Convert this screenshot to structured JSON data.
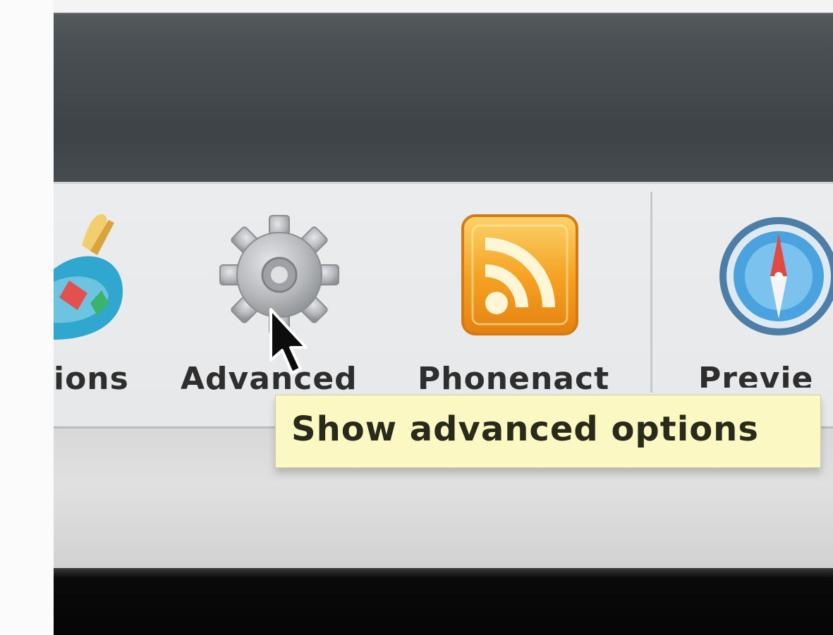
{
  "toolbar": {
    "items": [
      {
        "label": "ions",
        "icon": "extensions-icon"
      },
      {
        "label": "Advanced",
        "icon": "gear-icon"
      },
      {
        "label": "Phonenact",
        "icon": "rss-icon"
      },
      {
        "label": "Previe",
        "icon": "safari-compass-icon"
      }
    ]
  },
  "tooltip": {
    "text": "Show advanced options"
  },
  "colors": {
    "titlebar": "#42474b",
    "toolbar": "#e8eaec",
    "tooltip": "#fbf8c4",
    "rss_orange": "#f39a1c"
  }
}
